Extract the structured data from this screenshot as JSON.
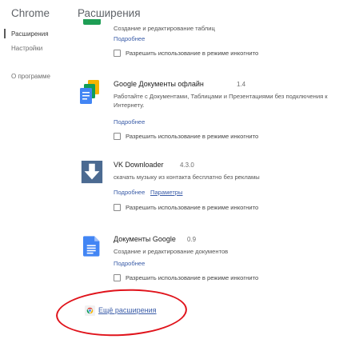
{
  "app": {
    "title": "Chrome"
  },
  "sidebar": {
    "items": [
      {
        "label": "Расширения",
        "active": true
      },
      {
        "label": "Настройки",
        "active": false
      },
      {
        "label": "О программе",
        "active": false
      }
    ]
  },
  "main": {
    "title": "Расширения",
    "extensions": [
      {
        "name": "",
        "version": "",
        "description": "Создание и редактирование таблиц",
        "details_link": "Подробнее",
        "incognito_label": "Разрешить использование в режиме инкогнито",
        "icon": "sheets-icon"
      },
      {
        "name": "Google Документы офлайн",
        "version": "1.4",
        "description": "Работайте с Документами, Таблицами и Презентациями без подключения к Интернету.",
        "details_link": "Подробнее",
        "incognito_label": "Разрешить использование в режиме инкогнито",
        "icon": "docs-offline-icon"
      },
      {
        "name": "VK Downloader",
        "version": "4.3.0",
        "description": "скачать музыку из контакта бесплатно без рекламы",
        "details_link": "Подробнее",
        "options_link": "Параметры",
        "incognito_label": "Разрешить использование в режиме инкогнито",
        "icon": "download-arrow-icon"
      },
      {
        "name": "Документы Google",
        "version": "0.9",
        "description": "Создание и редактирование документов",
        "details_link": "Подробнее",
        "incognito_label": "Разрешить использование в режиме инкогнито",
        "icon": "google-docs-icon"
      }
    ],
    "more_extensions_link": "Ещё расширения",
    "highlight_color": "#e0131b"
  }
}
